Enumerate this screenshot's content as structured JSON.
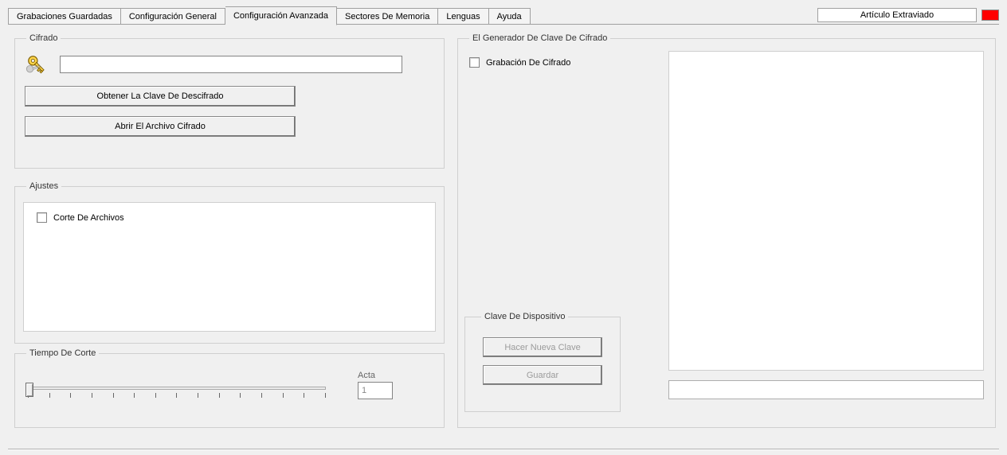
{
  "tabs": {
    "t0": "Grabaciones Guardadas",
    "t1": "Configuración General",
    "t2": "Configuración Avanzada",
    "t3": "Sectores De Memoria",
    "t4": "Lenguas",
    "t5": "Ayuda"
  },
  "active_tab_index": 2,
  "status": {
    "label": "Artículo   Extraviado",
    "color": "#ff0000"
  },
  "cifrado": {
    "legend": "Cifrado",
    "key_input_value": "",
    "btn_get_key": "Obtener La Clave De Descifrado",
    "btn_open_file": "Abrir El Archivo Cifrado"
  },
  "ajustes": {
    "legend": "Ajustes",
    "chk_cut_files": "Corte De Archivos",
    "chk_cut_files_checked": false
  },
  "tiempo": {
    "legend": "Tiempo De Corte",
    "acta_label": "Acta",
    "acta_value": "1",
    "slider_ticks": 15
  },
  "generador": {
    "legend": "El Generador De Clave De Cifrado",
    "chk_record": "Grabación De Cifrado",
    "chk_record_checked": false,
    "device_key": {
      "legend": "Clave De Dispositivo",
      "btn_new": "Hacer Nueva Clave",
      "btn_save": "Guardar"
    }
  }
}
